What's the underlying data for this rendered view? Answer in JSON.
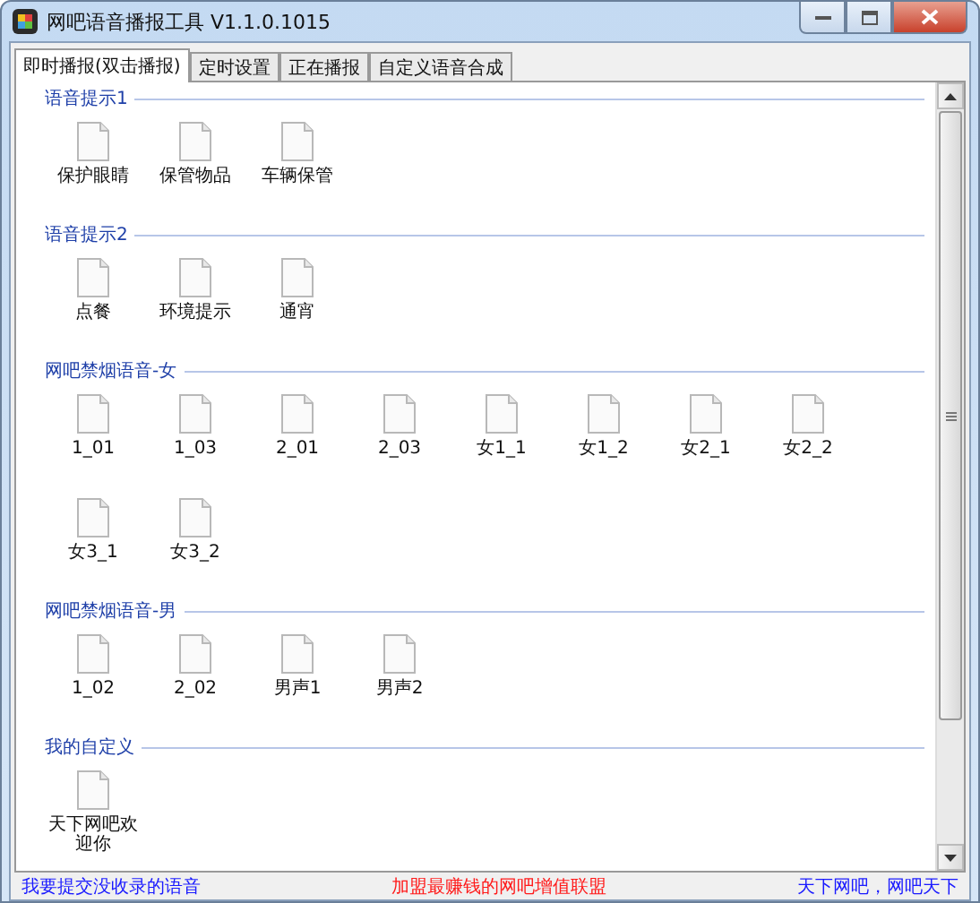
{
  "window": {
    "title": "网吧语音播报工具 V1.1.0.1015"
  },
  "tabs": [
    {
      "label": "即时播报(双击播报)",
      "selected": true
    },
    {
      "label": "定时设置",
      "selected": false
    },
    {
      "label": "正在播报",
      "selected": false
    },
    {
      "label": "自定义语音合成",
      "selected": false
    }
  ],
  "groups": [
    {
      "title": "语音提示1",
      "items": [
        "保护眼睛",
        "保管物品",
        "车辆保管"
      ]
    },
    {
      "title": "语音提示2",
      "items": [
        "点餐",
        "环境提示",
        "通宵"
      ]
    },
    {
      "title": "网吧禁烟语音-女",
      "items": [
        "1_01",
        "1_03",
        "2_01",
        "2_03",
        "女1_1",
        "女1_2",
        "女2_1",
        "女2_2",
        "女3_1",
        "女3_2"
      ]
    },
    {
      "title": "网吧禁烟语音-男",
      "items": [
        "1_02",
        "2_02",
        "男声1",
        "男声2"
      ]
    },
    {
      "title": "我的自定义",
      "items": [
        "天下网吧欢迎你"
      ]
    }
  ],
  "status_bar": [
    {
      "text": "我要提交没收录的语音",
      "color": "#1a1aff"
    },
    {
      "text": "加盟最赚钱的网吧增值联盟",
      "color": "#ff1a1a"
    },
    {
      "text": "天下网吧，网吧天下",
      "color": "#1a1aff"
    }
  ]
}
